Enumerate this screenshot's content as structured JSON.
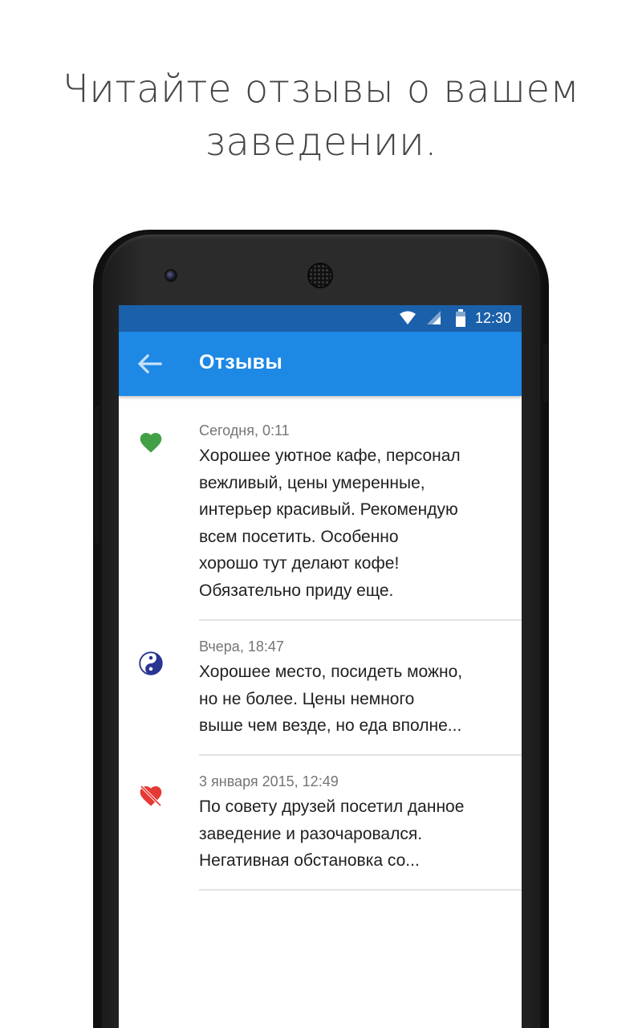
{
  "headline": {
    "line1": "Читайте отзывы о вашем",
    "line2": "заведении."
  },
  "status_bar": {
    "time": "12:30",
    "icons": [
      "wifi-icon",
      "signal-icon",
      "battery-icon"
    ]
  },
  "app_bar": {
    "title": "Отзывы",
    "back_icon": "arrow-back-icon",
    "color": "#1e88e5",
    "status_color": "#1b60aa"
  },
  "reviews": [
    {
      "icon": "heart-icon",
      "icon_color": "#43a047",
      "sentiment": "positive",
      "date": "Сегодня, 0:11",
      "lines": [
        "Хорошее уютное кафе, персонал",
        "вежливый, цены умеренные,",
        "интерьер красивый. Рекомендую",
        "всем посетить. Особенно",
        "хорошо тут делают кофе!",
        "Обязательно приду еще."
      ]
    },
    {
      "icon": "yin-yang-icon",
      "icon_color": "#283593",
      "sentiment": "neutral",
      "date": "Вчера, 18:47",
      "lines": [
        "Хорошее место, посидеть можно,",
        "но не более. Цены немного",
        "выше чем везде, но еда вполне..."
      ]
    },
    {
      "icon": "broken-heart-icon",
      "icon_color": "#e53935",
      "sentiment": "negative",
      "date": "3 января 2015, 12:49",
      "lines": [
        "По совету друзей посетил данное",
        "заведение и разочаровался.",
        "Негативная обстановка со..."
      ]
    }
  ]
}
